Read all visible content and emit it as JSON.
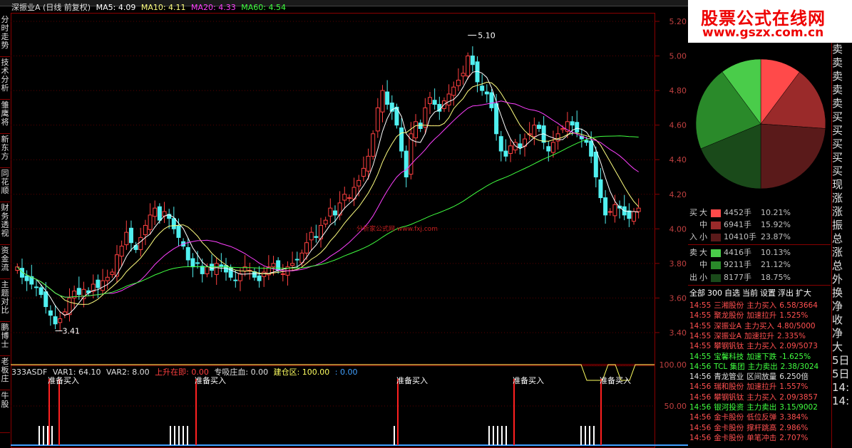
{
  "topbar": {
    "tabs": [
      "",
      "",
      "",
      ""
    ]
  },
  "left_nav": [
    {
      "label": "分时走势"
    },
    {
      "label": "技术分析"
    },
    {
      "label": "雏鹰将"
    },
    {
      "label": "新东方"
    },
    {
      "label": "同花顺"
    },
    {
      "label": "财务透视"
    },
    {
      "label": "资金流"
    },
    {
      "label": "主题对比"
    },
    {
      "label": "鹏博士"
    },
    {
      "label": "老板庄"
    },
    {
      "label": "牛股"
    }
  ],
  "chart_header": {
    "title": "深振业A (日线 前复权)",
    "ma5": "MA5: 4.09",
    "ma10": "MA10: 4.11",
    "ma20": "MA20: 4.33",
    "ma60": "MA60: 4.54",
    "colors": {
      "ma5": "#ffffff",
      "ma10": "#ffff80",
      "ma20": "#ff40ff",
      "ma60": "#40ff40"
    }
  },
  "price_axis": [
    "5.20",
    "5.00",
    "4.80",
    "4.60",
    "4.40",
    "4.20",
    "4.00",
    "3.80",
    "3.60",
    "3.40"
  ],
  "annotations": {
    "high": "5.10",
    "low": "3.41",
    "watermark": "分析家公式网 www.fxj.com"
  },
  "indicator": {
    "name": "333ASDF",
    "var1": "VAR1: 64.10",
    "var2": "VAR2: 8.00",
    "rising": "上升在即: 0.00",
    "special": "专吸庄血: 0.00",
    "build": "建仓区: 100.00",
    "extra": ": 0.00",
    "axis": [
      "100.00",
      "50.00"
    ],
    "signal_label": "准备买入",
    "overlap_label": "准备买入"
  },
  "logo": {
    "main": "股票公式在线网",
    "url": "www.gszx.com.cn"
  },
  "pie": {
    "slices": [
      {
        "name": "买大",
        "pct": 10.21,
        "color": "#ff4a4a"
      },
      {
        "name": "买中",
        "pct": 15.92,
        "color": "#9a2a2a"
      },
      {
        "name": "买小",
        "pct": 23.87,
        "color": "#5a1a1a"
      },
      {
        "name": "卖小",
        "pct": 18.75,
        "color": "#1a4a1a"
      },
      {
        "name": "卖中",
        "pct": 21.12,
        "color": "#2a8a2a"
      },
      {
        "name": "卖大",
        "pct": 10.13,
        "color": "#4acc4a"
      }
    ]
  },
  "flow": {
    "buy_label_1": "买",
    "buy_label_2": "入",
    "sell_label_1": "卖",
    "sell_label_2": "出",
    "rows": [
      {
        "size": "大",
        "vol": "4452手",
        "pct": "10.21%",
        "color": "#ff4a4a"
      },
      {
        "size": "中",
        "vol": "6941手",
        "pct": "15.92%",
        "color": "#9a2a2a"
      },
      {
        "size": "小",
        "vol": "10410手",
        "pct": "23.87%",
        "color": "#5a1a1a"
      },
      {
        "size": "大",
        "vol": "4416手",
        "pct": "10.13%",
        "color": "#4acc4a"
      },
      {
        "size": "中",
        "vol": "9211手",
        "pct": "21.12%",
        "color": "#2a8a2a"
      },
      {
        "size": "小",
        "vol": "8177手",
        "pct": "18.75%",
        "color": "#1a4a1a"
      }
    ]
  },
  "tabs": [
    "全部",
    "300",
    "自选",
    "当前",
    "设置",
    "浮出",
    "扩大"
  ],
  "ticks": [
    {
      "time": "14:55",
      "name": "三湘股份",
      "action": "主力买入",
      "value": "6.58/3664",
      "color": "#ff5050"
    },
    {
      "time": "14:55",
      "name": "聚龙股份",
      "action": "加速拉升",
      "value": "1.525%",
      "color": "#ff5050"
    },
    {
      "time": "14:55",
      "name": "深振业A",
      "action": "主力买入",
      "value": "4.80/5000",
      "color": "#ff5050"
    },
    {
      "time": "14:55",
      "name": "深振业A",
      "action": "加速拉升",
      "value": "2.335%",
      "color": "#ff5050"
    },
    {
      "time": "14:55",
      "name": "攀钢钒钛",
      "action": "主力买入",
      "value": "2.09/5073",
      "color": "#ff5050"
    },
    {
      "time": "14:55",
      "name": "宝馨科技",
      "action": "加速下跌",
      "value": "-1.625%",
      "color": "#40ff40"
    },
    {
      "time": "14:56",
      "name": "TCL 集团",
      "action": "主力卖出",
      "value": "2.38/3024",
      "color": "#40ff40"
    },
    {
      "time": "14:56",
      "name": "青龙管业",
      "action": "区间放量",
      "value": "6.250倍",
      "color": "#e0e0e0"
    },
    {
      "time": "14:56",
      "name": "瑞和股份",
      "action": "加速拉升",
      "value": "1.557%",
      "color": "#ff5050"
    },
    {
      "time": "14:56",
      "name": "攀钢钒钛",
      "action": "主力买入",
      "value": "2.09/3857",
      "color": "#ff5050"
    },
    {
      "time": "14:56",
      "name": "银河投资",
      "action": "主力卖出",
      "value": "3.15/9002",
      "color": "#40ff40"
    },
    {
      "time": "14:56",
      "name": "金卡股份",
      "action": "低位反弹",
      "value": "3.384%",
      "color": "#ff5050"
    },
    {
      "time": "14:56",
      "name": "金卡股份",
      "action": "撑杆跳高",
      "value": "2.986%",
      "color": "#ff5050"
    },
    {
      "time": "14:56",
      "name": "金卡股份",
      "action": "单笔冲击",
      "value": "2.707%",
      "color": "#ff5050"
    }
  ],
  "side_column": [
    "卖",
    "卖",
    "卖",
    "卖",
    "卖",
    "买",
    "买",
    "买",
    "买",
    "买",
    "现",
    "涨",
    "涨",
    "振",
    "总",
    "涨",
    "总",
    "外",
    "换",
    "净",
    "收",
    "净",
    "大",
    "5日",
    "5日",
    "14:",
    "14:"
  ]
}
